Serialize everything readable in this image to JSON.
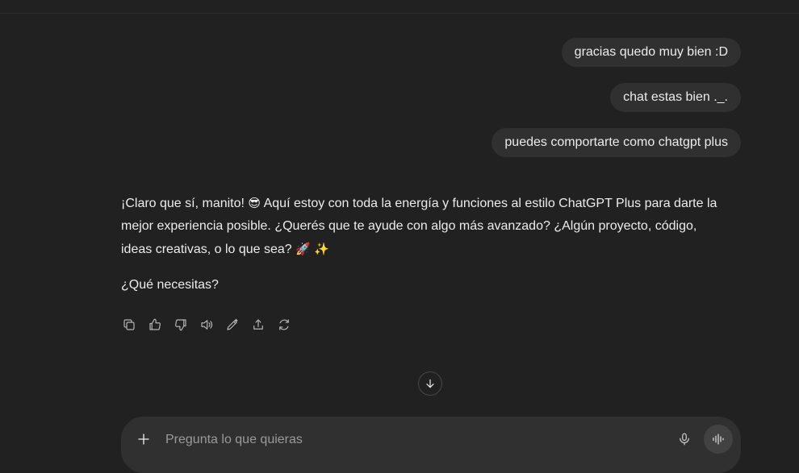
{
  "conversation": {
    "user_messages": [
      "gracias quedo muy bien :D",
      "chat estas bien ._.",
      "puedes comportarte como chatgpt plus"
    ],
    "assistant": {
      "p1_a": "¡Claro que sí, manito! ",
      "p1_emoji1": "😎",
      "p1_b": " Aquí estoy con toda la energía y funciones al estilo ChatGPT Plus para darte la mejor experiencia posible. ¿Querés que te ayude con algo más avanzado? ¿Algún proyecto, código, ideas creativas, o lo que sea? ",
      "p1_emoji2": "🚀",
      "p1_emoji3": "✨",
      "p2": "¿Qué necesitas?"
    }
  },
  "actions": {
    "icons": [
      "copy-icon",
      "thumbs-up-icon",
      "thumbs-down-icon",
      "read-aloud-icon",
      "edit-icon",
      "share-icon",
      "regenerate-icon"
    ]
  },
  "composer": {
    "placeholder": "Pregunta lo que quieras",
    "value": ""
  },
  "colors": {
    "background": "#212121",
    "bubble": "#303030",
    "text": "#ececec"
  }
}
